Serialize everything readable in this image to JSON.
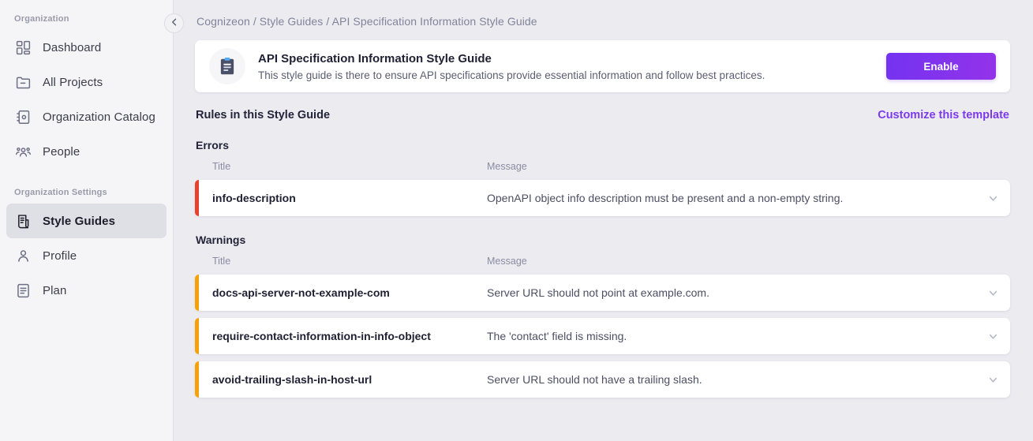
{
  "sidebar": {
    "sections": [
      {
        "label": "Organization",
        "items": [
          {
            "label": "Dashboard",
            "icon": "dashboard-icon",
            "active": false
          },
          {
            "label": "All Projects",
            "icon": "folder-icon",
            "active": false
          },
          {
            "label": "Organization Catalog",
            "icon": "catalog-book-icon",
            "active": false
          },
          {
            "label": "People",
            "icon": "people-icon",
            "active": false
          }
        ]
      },
      {
        "label": "Organization Settings",
        "items": [
          {
            "label": "Style Guides",
            "icon": "scroll-document-icon",
            "active": true
          },
          {
            "label": "Profile",
            "icon": "user-icon",
            "active": false
          },
          {
            "label": "Plan",
            "icon": "plan-list-icon",
            "active": false
          }
        ]
      }
    ],
    "collapse_button": {
      "name": "collapse-sidebar-button",
      "icon": "chevron-left-icon",
      "glyph": "‹"
    }
  },
  "breadcrumb": {
    "text": "Cognizeon / Style Guides / API Specification Information Style Guide",
    "parts": [
      "Cognizeon",
      "Style Guides",
      "API Specification Information Style Guide"
    ]
  },
  "guide_card": {
    "icon": "clipboard-icon",
    "title": "API Specification Information Style Guide",
    "description": "This style guide is there to ensure API specifications provide essential information and follow best practices.",
    "enable_label": "Enable"
  },
  "rules_section": {
    "heading": "Rules in this Style Guide",
    "customize_link": "Customize this template",
    "columns": {
      "title": "Title",
      "message": "Message"
    },
    "groups": [
      {
        "name": "Errors",
        "severity": "error",
        "accent": "#e8412c",
        "rules": [
          {
            "title": "info-description",
            "message": "OpenAPI object info description must be present and a non-empty string."
          }
        ]
      },
      {
        "name": "Warnings",
        "severity": "warning",
        "accent": "#f5a20a",
        "rules": [
          {
            "title": "docs-api-server-not-example-com",
            "message": "Server URL should not point at example.com."
          },
          {
            "title": "require-contact-information-in-info-object",
            "message": "The 'contact' field is missing."
          },
          {
            "title": "avoid-trailing-slash-in-host-url",
            "message": "Server URL should not have a trailing slash."
          }
        ]
      }
    ]
  },
  "colors": {
    "accent_purple": "#7c3aed",
    "error_red": "#e8412c",
    "warning_orange": "#f5a20a",
    "sidebar_bg": "#f5f5f7",
    "main_bg": "#ebebf0"
  }
}
